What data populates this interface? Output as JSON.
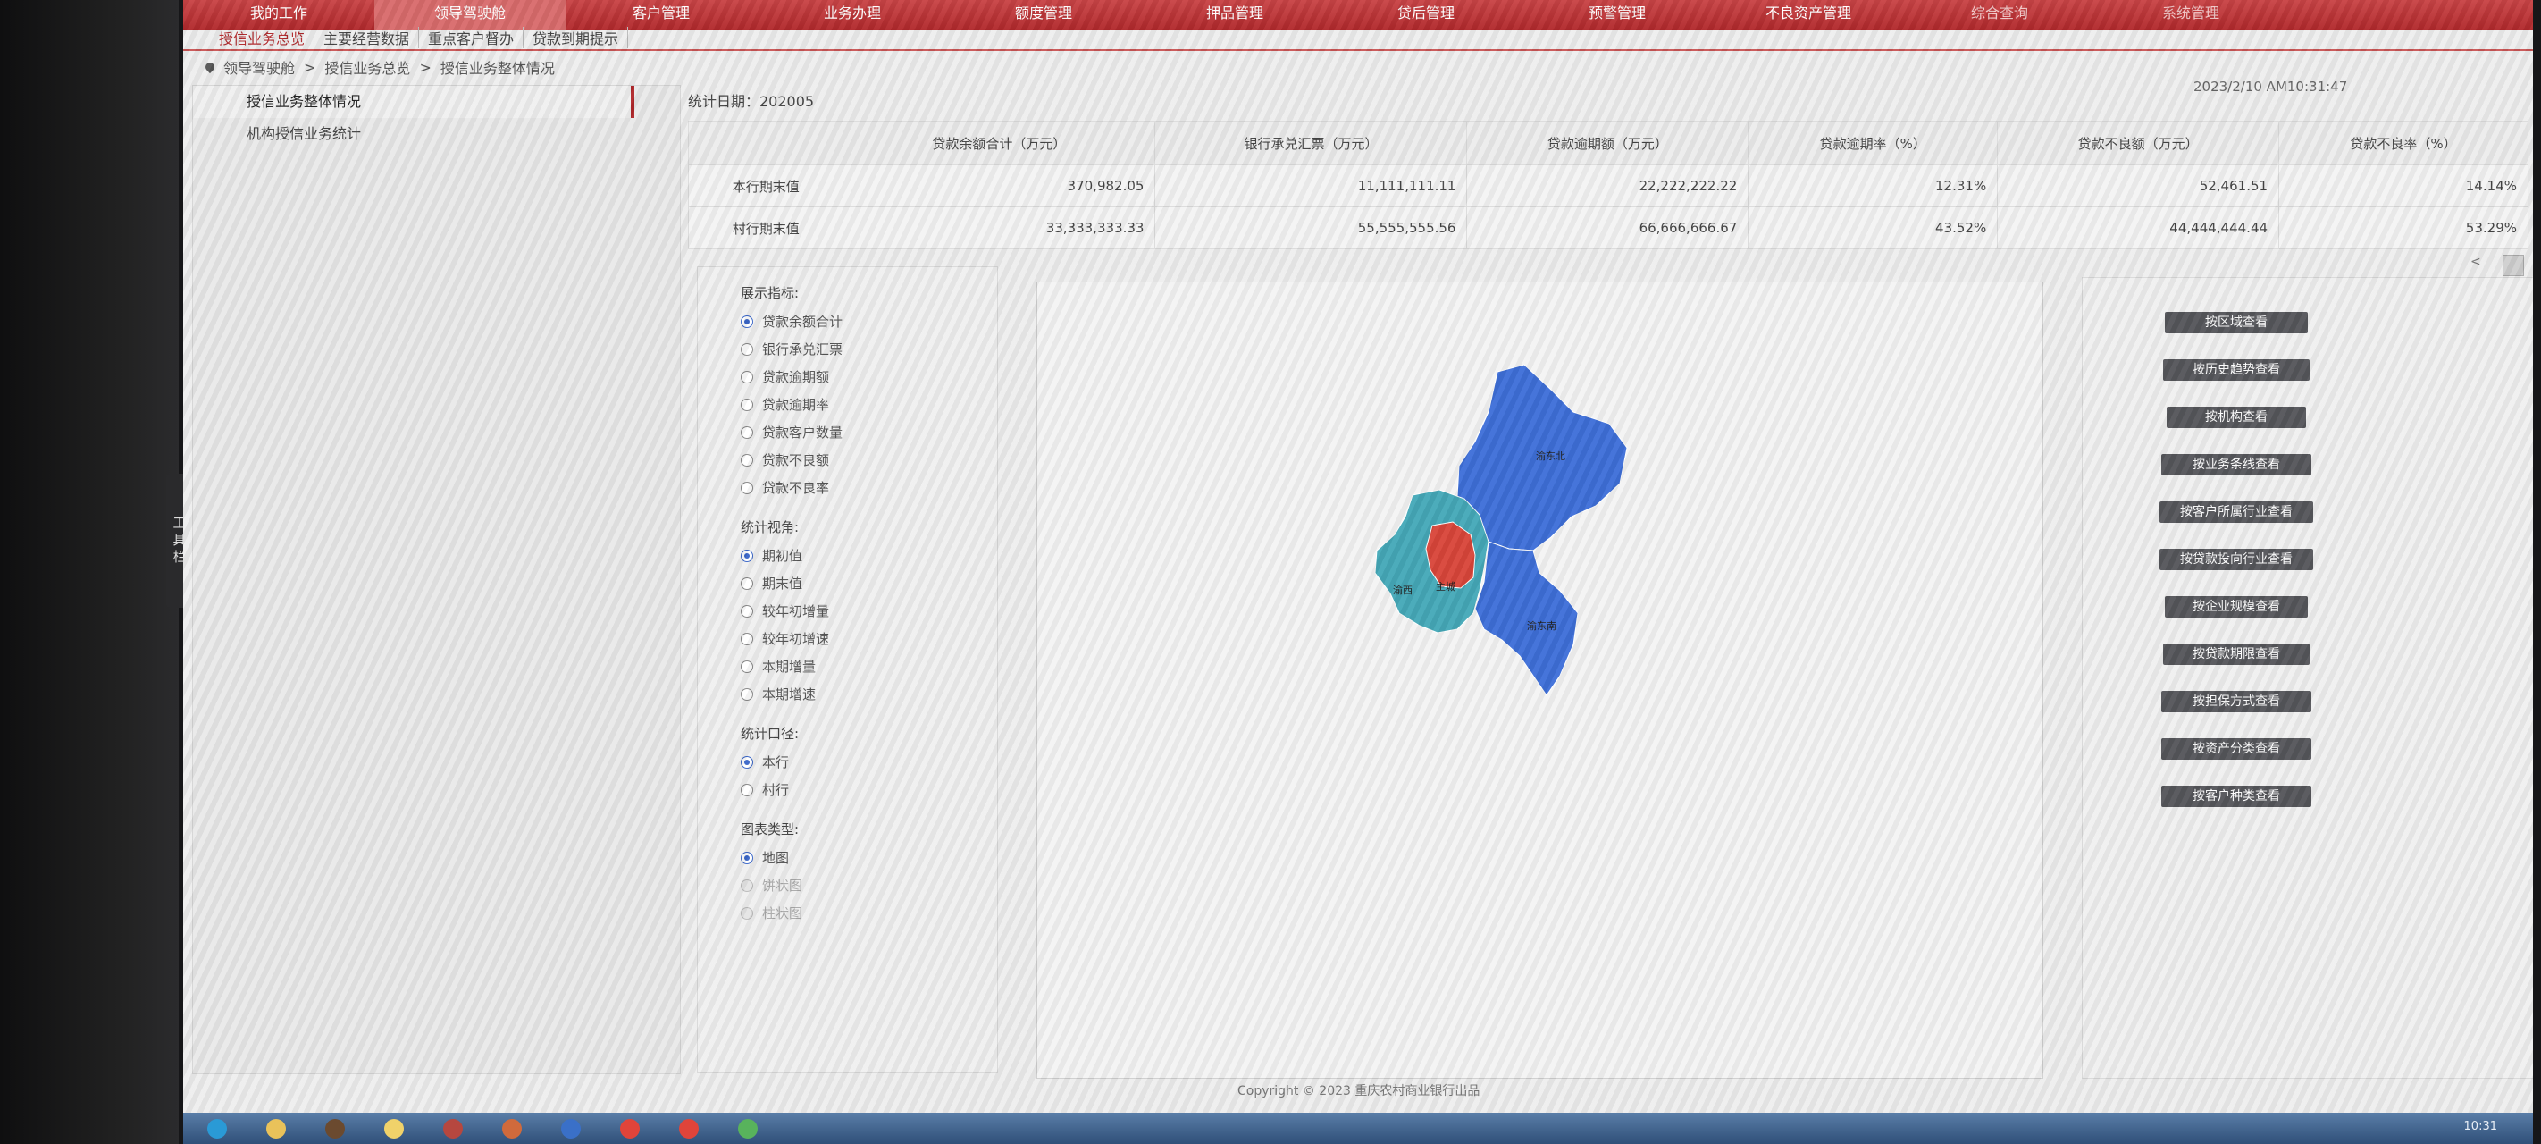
{
  "nav": {
    "items": [
      "我的工作",
      "领导驾驶舱",
      "客户管理",
      "业务办理",
      "额度管理",
      "押品管理",
      "贷后管理",
      "预警管理",
      "不良资产管理",
      "综合查询",
      "系统管理"
    ],
    "active_index": 1
  },
  "subtabs": {
    "items": [
      "授信业务总览",
      "主要经营数据",
      "重点客户督办",
      "贷款到期提示"
    ],
    "active_index": 0
  },
  "breadcrumb": [
    "领导驾驶舱",
    "授信业务总览",
    "授信业务整体情况"
  ],
  "left_menu": {
    "items": [
      "授信业务整体情况",
      "机构授信业务统计"
    ],
    "active_index": 0
  },
  "toolbox_label": "工具栏",
  "stat_date": "统计日期：202005",
  "timestamp": "2023/2/10 AM10:31:47",
  "table": {
    "headers": [
      "",
      "贷款余额合计（万元）",
      "银行承兑汇票（万元）",
      "贷款逾期额（万元）",
      "贷款逾期率（%）",
      "贷款不良额（万元）",
      "贷款不良率（%）"
    ],
    "rows": [
      [
        "本行期末值",
        "370,982.05",
        "11,111,111.11",
        "22,222,222.22",
        "12.31%",
        "52,461.51",
        "14.14%"
      ],
      [
        "村行期末值",
        "33,333,333.33",
        "55,555,555.56",
        "66,666,666.67",
        "43.52%",
        "44,444,444.44",
        "53.29%"
      ]
    ]
  },
  "filters": {
    "indicator": {
      "label": "展示指标:",
      "options": [
        "贷款余额合计",
        "银行承兑汇票",
        "贷款逾期额",
        "贷款逾期率",
        "贷款客户数量",
        "贷款不良额",
        "贷款不良率"
      ],
      "selected": 0
    },
    "caliber": {
      "label": "统计视角:",
      "options": [
        "期初值",
        "期末值",
        "较年初增量",
        "较年初增速",
        "本期增量",
        "本期增速"
      ],
      "selected": 0
    },
    "scope": {
      "label": "统计口径:",
      "options": [
        "本行",
        "村行"
      ],
      "selected": 0
    },
    "chart_type": {
      "label": "图表类型:",
      "options": [
        "地图",
        "饼状图",
        "柱状图"
      ],
      "selected": 0,
      "disabled": [
        1,
        2
      ]
    }
  },
  "map": {
    "regions": [
      {
        "name": "渝东北",
        "color": "#3e6fd8"
      },
      {
        "name": "渝西",
        "color": "#45a9b8"
      },
      {
        "name": "主城",
        "color": "#d9463a"
      },
      {
        "name": "渝东南",
        "color": "#3e6fd8"
      }
    ]
  },
  "buttons": [
    "按区域查看",
    "按历史趋势查看",
    "按机构查看",
    "按业务条线查看",
    "按客户所属行业查看",
    "按贷款投向行业查看",
    "按企业规模查看",
    "按贷款期限查看",
    "按担保方式查看",
    "按资产分类查看",
    "按客户种类查看"
  ],
  "footer": "Copyright © 2023 重庆农村商业银行出品",
  "taskbar": {
    "clock": "10:31",
    "icons": [
      {
        "name": "start",
        "color": "#2a9ad6"
      },
      {
        "name": "folder",
        "color": "#e9c25a"
      },
      {
        "name": "app",
        "color": "#6b4a2f"
      },
      {
        "name": "notes",
        "color": "#f0d26a"
      },
      {
        "name": "database",
        "color": "#b6473f"
      },
      {
        "name": "tool",
        "color": "#d06a3c"
      },
      {
        "name": "editor",
        "color": "#3a70c8"
      },
      {
        "name": "chrome",
        "color": "#e0443a"
      },
      {
        "name": "chrome-2",
        "color": "#e0443a"
      },
      {
        "name": "network",
        "color": "#58b35c"
      }
    ]
  }
}
